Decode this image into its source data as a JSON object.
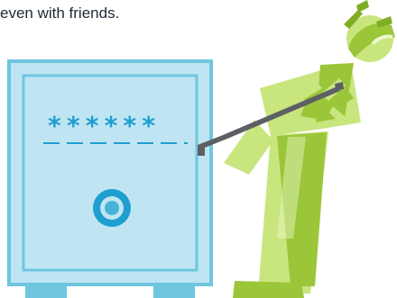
{
  "caption": {
    "text": "even with friends."
  },
  "safe": {
    "password_mask": "******",
    "icon": "safe-icon"
  },
  "figure": {
    "icon": "burglar-figure-icon"
  },
  "crowbar": {
    "icon": "crowbar-icon"
  },
  "colors": {
    "safe_fill": "#bfe5f3",
    "safe_border": "#6fc6df",
    "safe_accent": "#1f9ed0",
    "figure_light": "#c9e57e",
    "figure_dark": "#9cc63a",
    "crowbar": "#5d5f63"
  }
}
